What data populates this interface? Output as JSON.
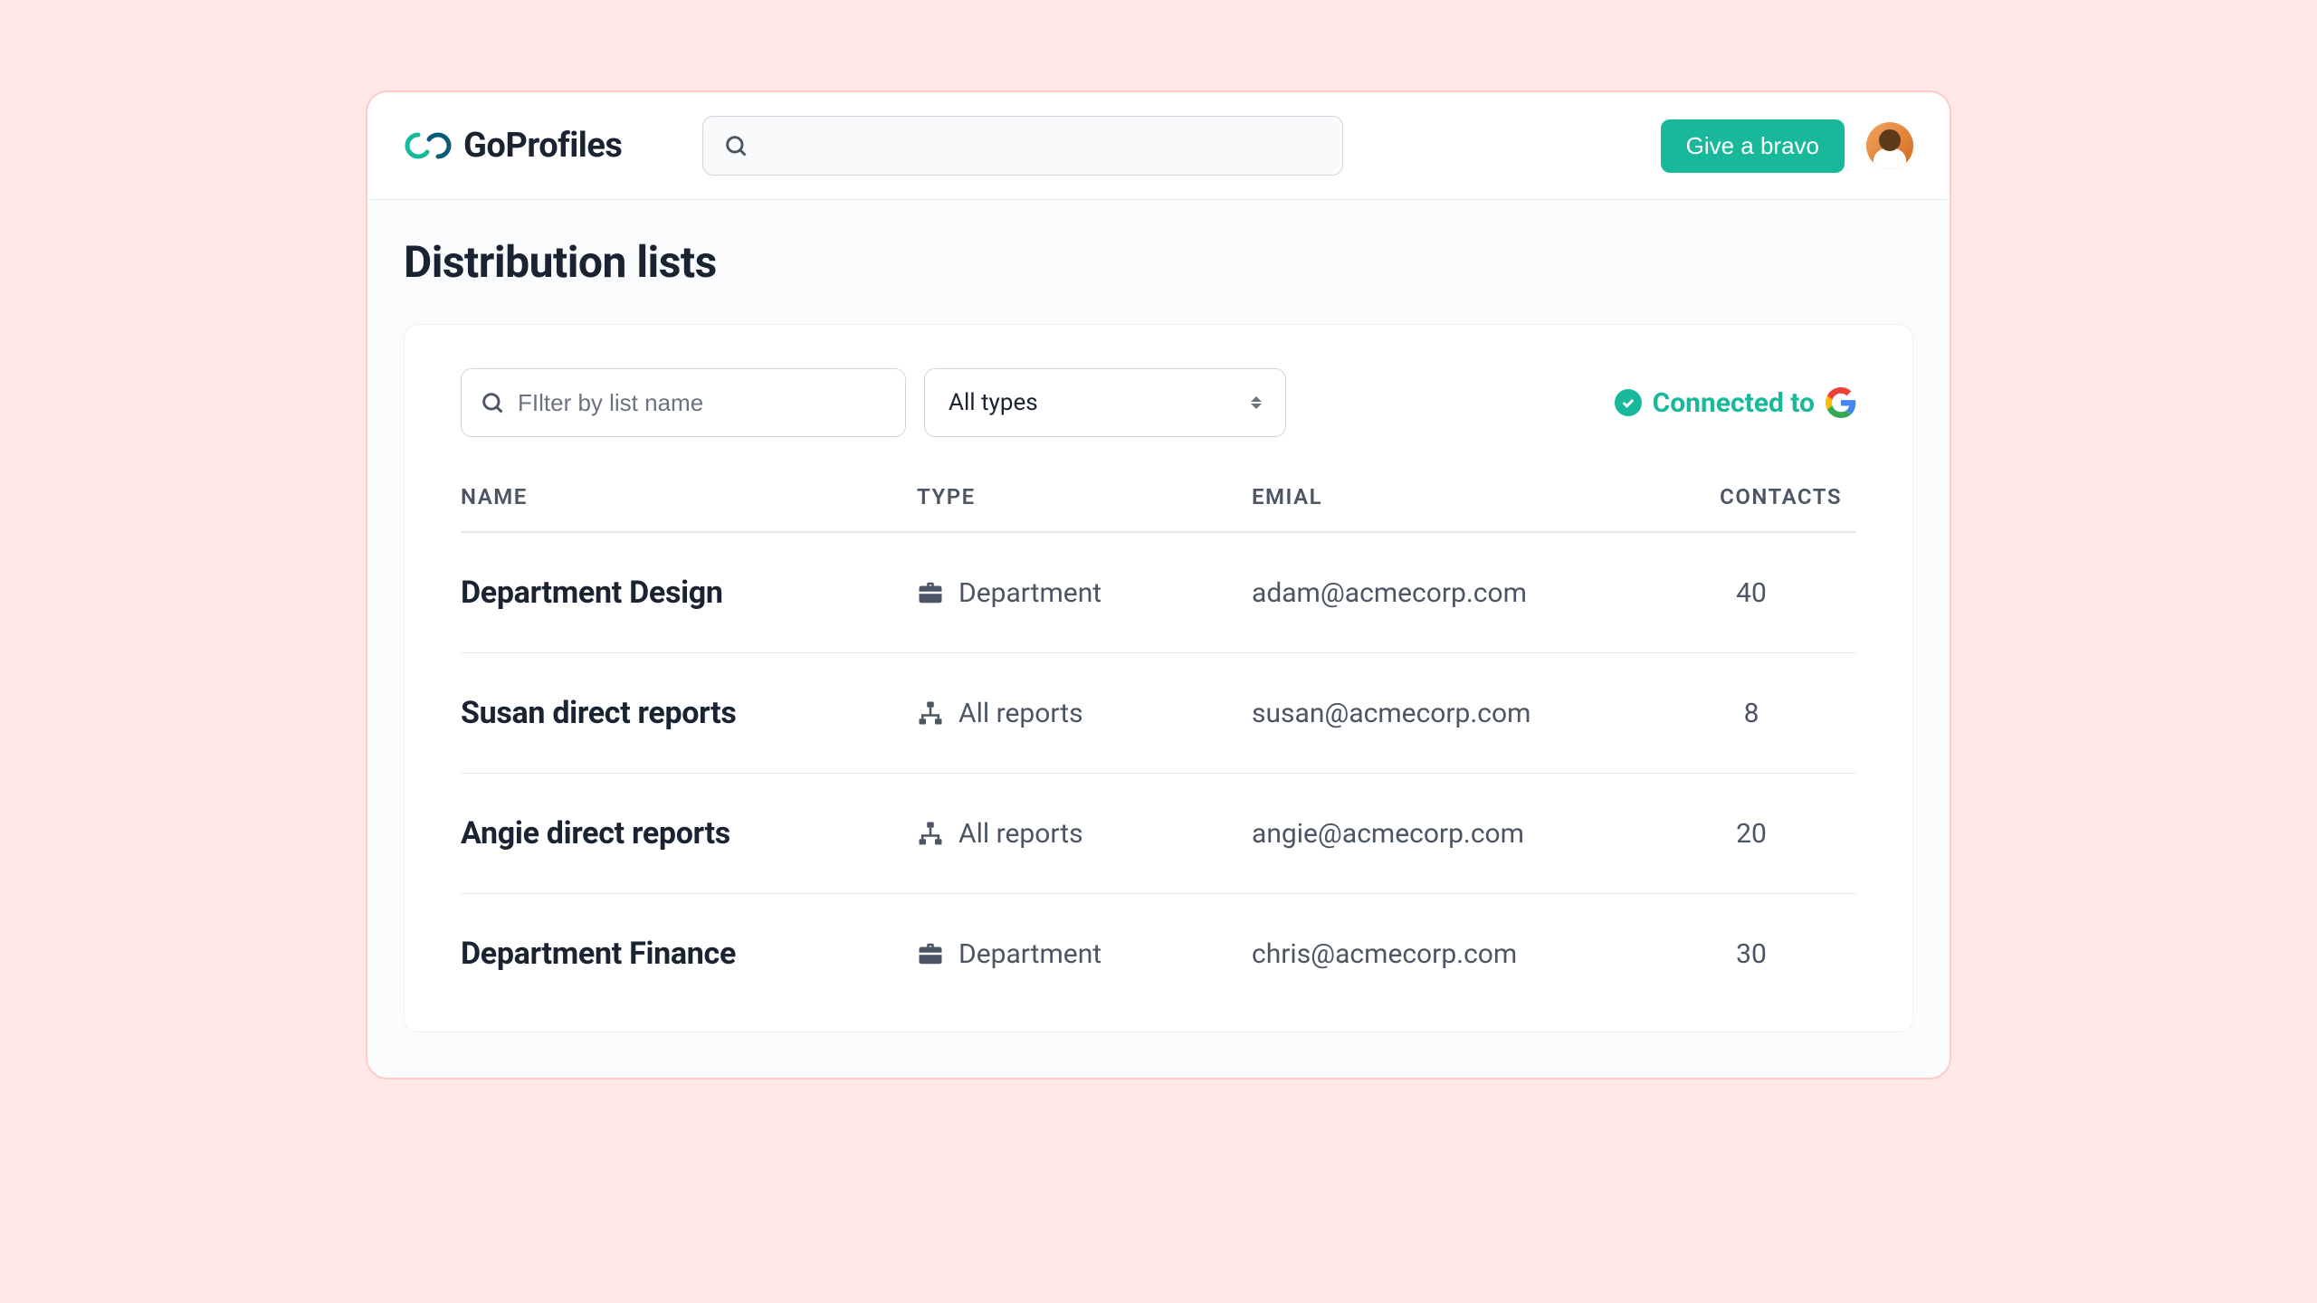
{
  "header": {
    "logo_text": "GoProfiles",
    "bravo_button_label": "Give a bravo"
  },
  "page": {
    "title": "Distribution lists"
  },
  "toolbar": {
    "filter_placeholder": "FIlter by list name",
    "select_label": "All types",
    "connection_text": "Connected to"
  },
  "table": {
    "headers": {
      "name": "NAME",
      "type": "TYPE",
      "email": "EMIAL",
      "contacts": "CONTACTS"
    },
    "rows": [
      {
        "name": "Department Design",
        "type": "Department",
        "type_icon": "briefcase",
        "email": "adam@acmecorp.com",
        "contacts": "40"
      },
      {
        "name": "Susan direct reports",
        "type": "All reports",
        "type_icon": "hierarchy",
        "email": "susan@acmecorp.com",
        "contacts": "8"
      },
      {
        "name": "Angie direct reports",
        "type": "All reports",
        "type_icon": "hierarchy",
        "email": "angie@acmecorp.com",
        "contacts": "20"
      },
      {
        "name": "Department Finance",
        "type": "Department",
        "type_icon": "briefcase",
        "email": "chris@acmecorp.com",
        "contacts": "30"
      }
    ]
  }
}
